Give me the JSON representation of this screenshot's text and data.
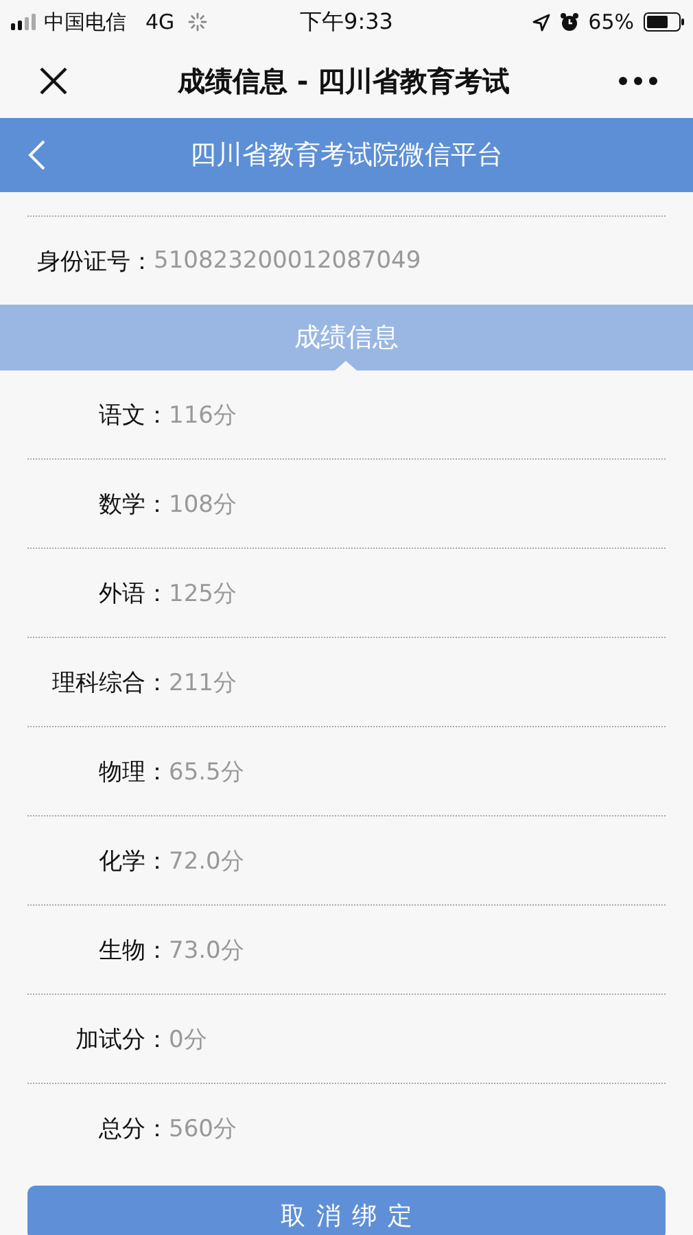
{
  "status_bar": {
    "carrier": "中国电信",
    "network": "4G",
    "time": "下午9:33",
    "battery": "65%"
  },
  "nav_bar": {
    "title": "成绩信息 - 四川省教育考试"
  },
  "header": {
    "title": "四川省教育考试院微信平台"
  },
  "id_field": {
    "label": "身份证号：",
    "value": "510823200012087049"
  },
  "section": {
    "title": "成绩信息"
  },
  "scores": [
    {
      "label": "语文：",
      "value": "116分"
    },
    {
      "label": "数学：",
      "value": "108分"
    },
    {
      "label": "外语：",
      "value": "125分"
    },
    {
      "label": "理科综合：",
      "value": "211分"
    },
    {
      "label": "物理：",
      "value": "65.5分"
    },
    {
      "label": "化学：",
      "value": "72.0分"
    },
    {
      "label": "生物：",
      "value": "73.0分"
    },
    {
      "label": "加试分：",
      "value": "0分"
    },
    {
      "label": "总分：",
      "value": "560分"
    }
  ],
  "button": {
    "label": "取消绑定"
  }
}
